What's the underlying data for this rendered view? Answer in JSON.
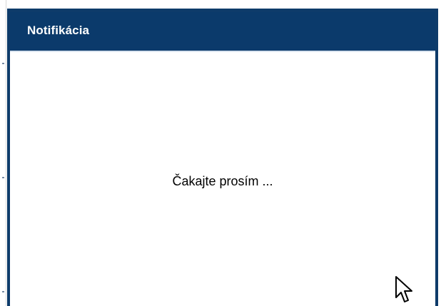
{
  "dialog": {
    "title": "Notifikácia",
    "message": "Čakajte prosím ..."
  },
  "colors": {
    "header_background": "#0b3a6b",
    "header_text": "#ffffff",
    "body_background": "#ffffff",
    "message_text": "#000000"
  },
  "icons": {
    "cursor": "mouse-pointer-icon"
  }
}
